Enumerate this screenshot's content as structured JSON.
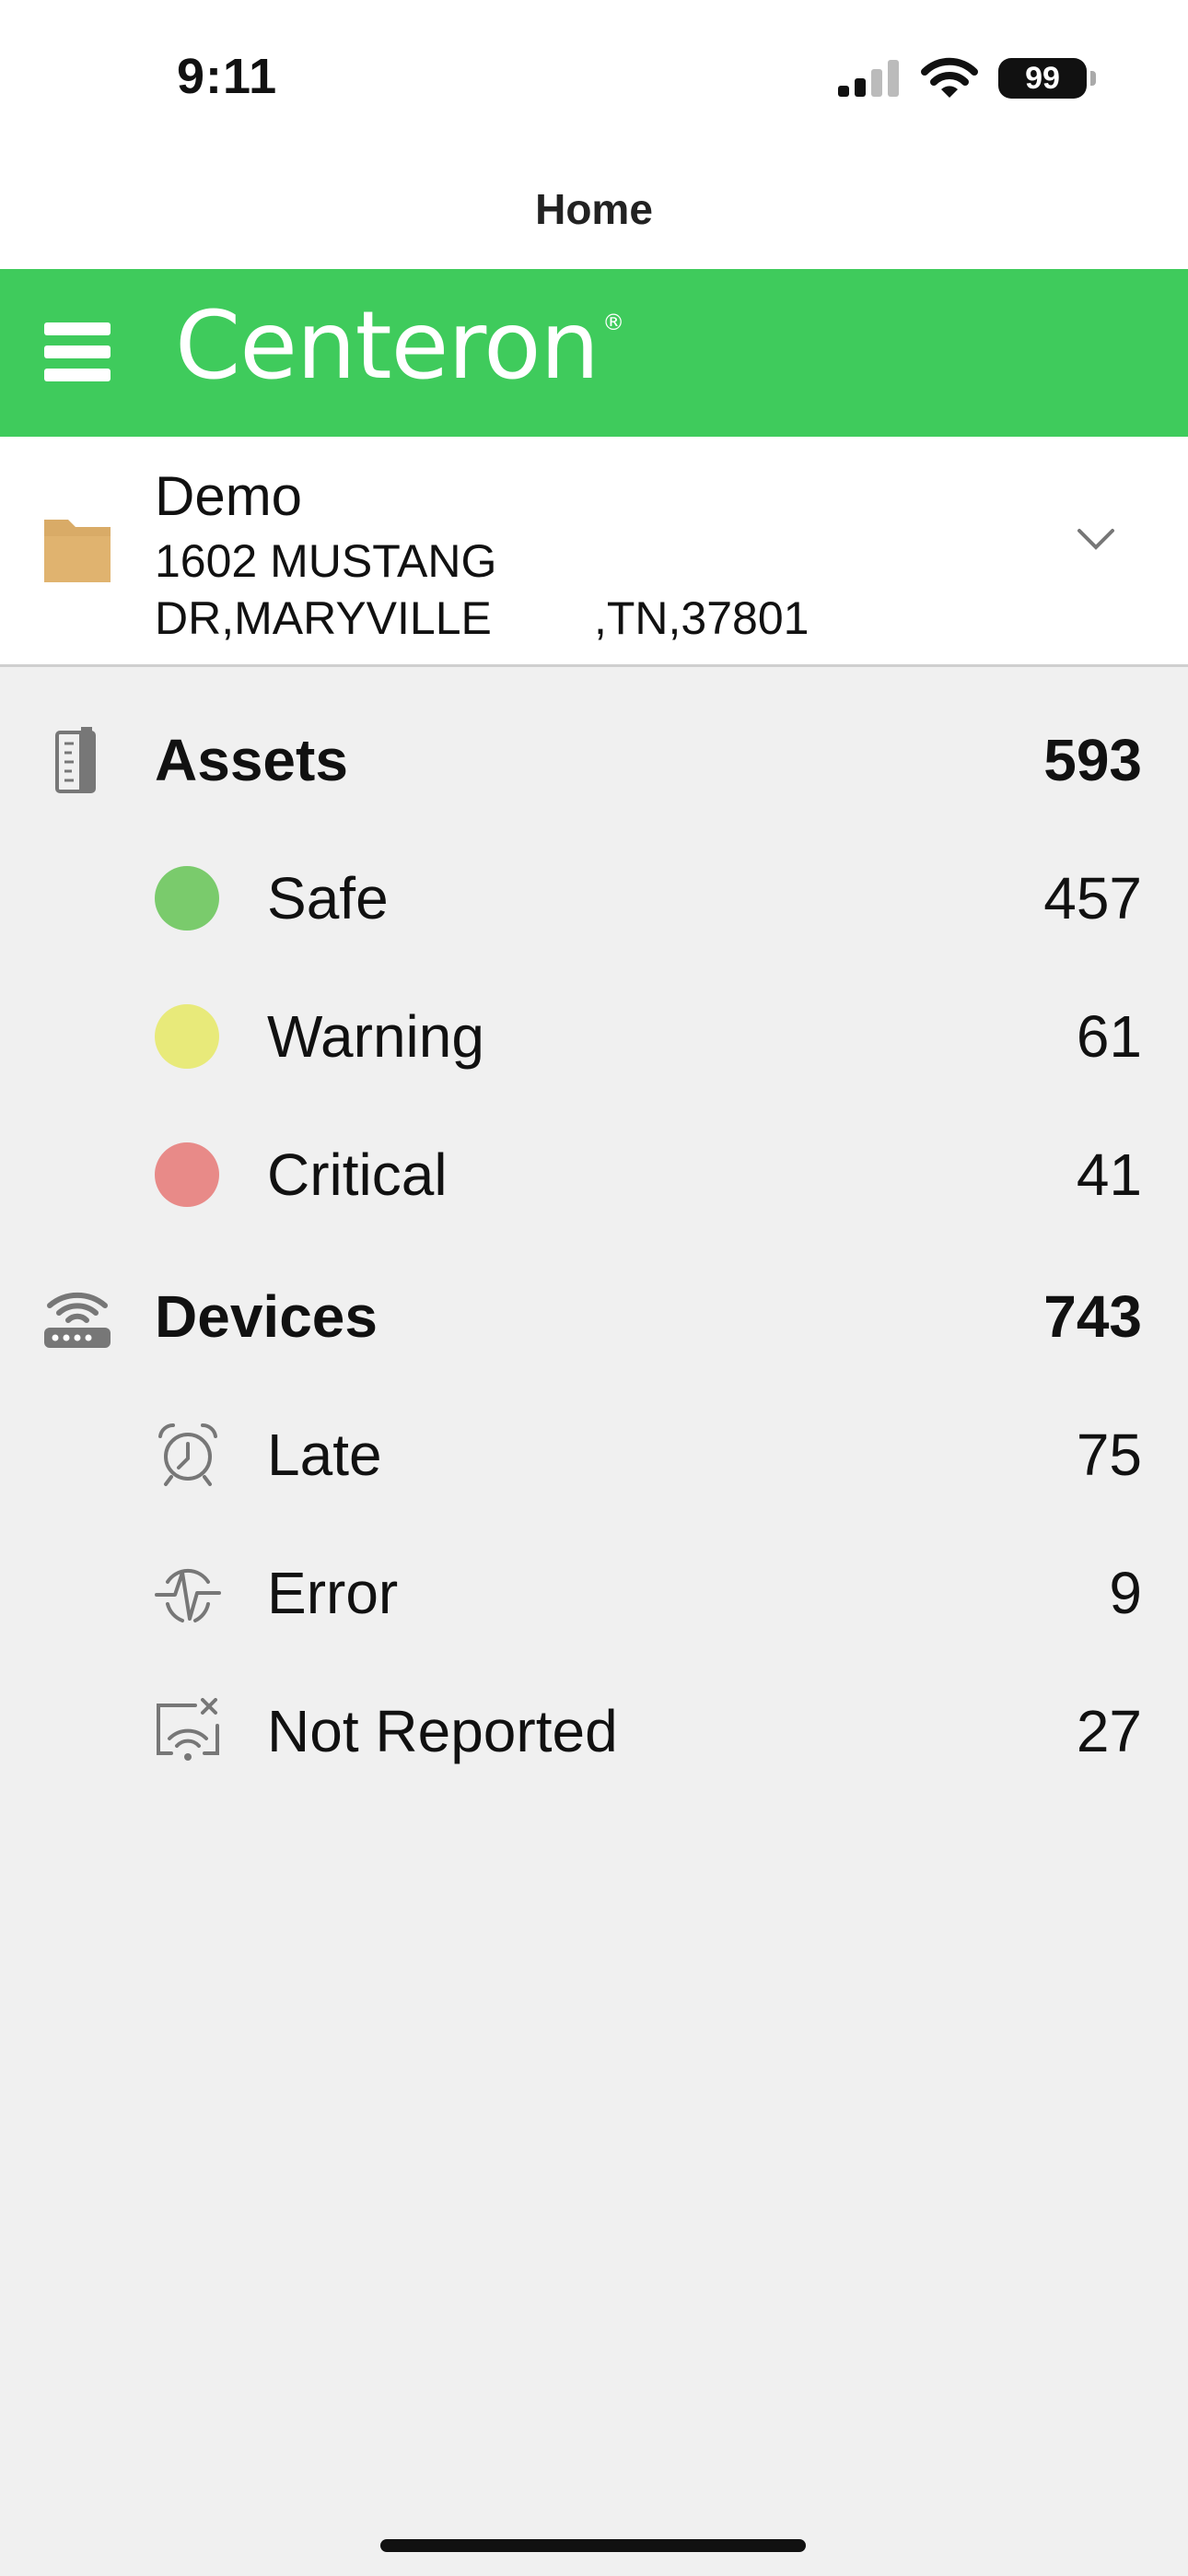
{
  "status_bar": {
    "time": "9:11",
    "battery": "99"
  },
  "nav": {
    "title": "Home"
  },
  "header": {
    "logo_text": "Centeron",
    "logo_mark": "®",
    "brand_color": "#3fcb5c"
  },
  "location": {
    "name": "Demo",
    "address_line1": "1602 MUSTANG",
    "address_line2": "DR,MARYVILLE        ,TN,37801"
  },
  "assets": {
    "label": "Assets",
    "count": "593",
    "items": [
      {
        "label": "Safe",
        "count": "457",
        "color": "#7acb6c"
      },
      {
        "label": "Warning",
        "count": "61",
        "color": "#e8ea7a"
      },
      {
        "label": "Critical",
        "count": "41",
        "color": "#e88a88"
      }
    ]
  },
  "devices": {
    "label": "Devices",
    "count": "743",
    "items": [
      {
        "label": "Late",
        "count": "75",
        "icon": "alarm-clock-icon"
      },
      {
        "label": "Error",
        "count": "9",
        "icon": "pulse-error-icon"
      },
      {
        "label": "Not Reported",
        "count": "27",
        "icon": "wifi-off-icon"
      }
    ]
  }
}
